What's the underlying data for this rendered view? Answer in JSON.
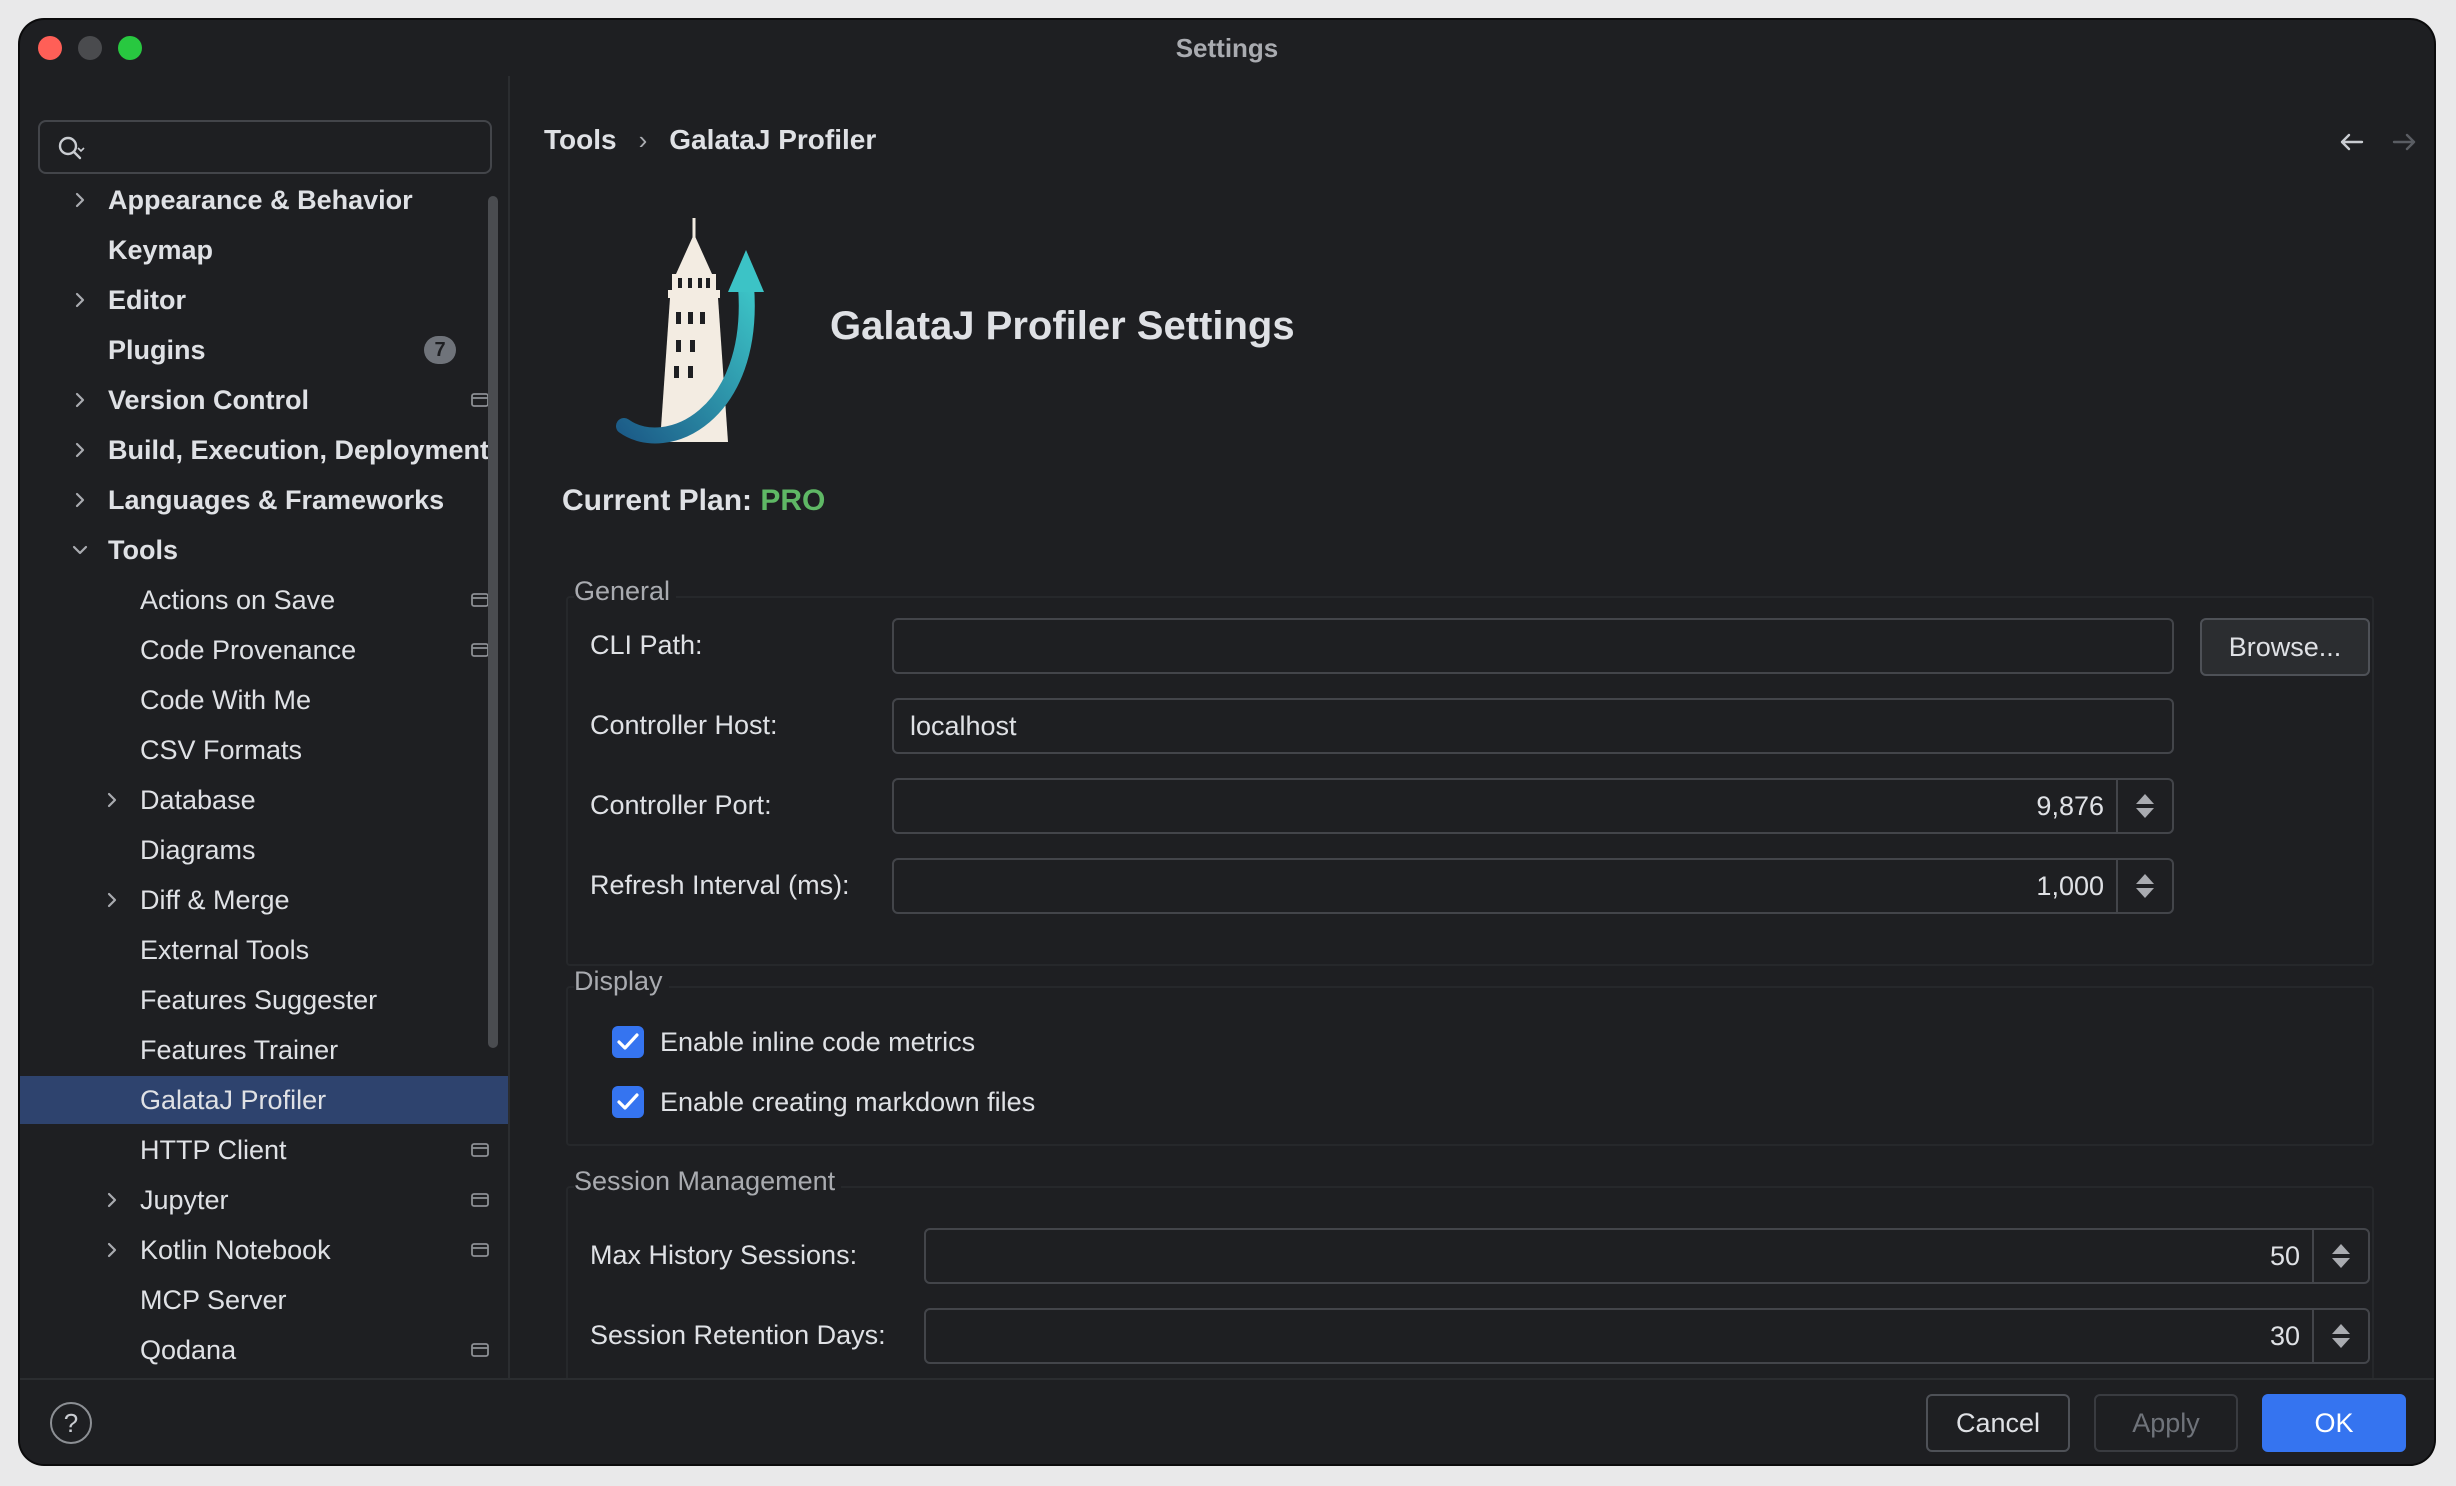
{
  "window": {
    "title": "Settings"
  },
  "search": {
    "placeholder": ""
  },
  "sidebar": {
    "items": [
      {
        "label": "Appearance & Behavior",
        "bold": true,
        "expandable": true,
        "expanded": false,
        "indent": 0
      },
      {
        "label": "Keymap",
        "bold": true,
        "expandable": false,
        "indent": 0
      },
      {
        "label": "Editor",
        "bold": true,
        "expandable": true,
        "expanded": false,
        "indent": 0
      },
      {
        "label": "Plugins",
        "bold": true,
        "expandable": false,
        "indent": 0,
        "badge": "7"
      },
      {
        "label": "Version Control",
        "bold": true,
        "expandable": true,
        "expanded": false,
        "indent": 0,
        "project_icon": true
      },
      {
        "label": "Build, Execution, Deployment",
        "bold": true,
        "expandable": true,
        "expanded": false,
        "indent": 0
      },
      {
        "label": "Languages & Frameworks",
        "bold": true,
        "expandable": true,
        "expanded": false,
        "indent": 0
      },
      {
        "label": "Tools",
        "bold": true,
        "expandable": true,
        "expanded": true,
        "indent": 0
      },
      {
        "label": "Actions on Save",
        "indent": 1,
        "project_icon": true
      },
      {
        "label": "Code Provenance",
        "indent": 1,
        "project_icon": true
      },
      {
        "label": "Code With Me",
        "indent": 1
      },
      {
        "label": "CSV Formats",
        "indent": 1
      },
      {
        "label": "Database",
        "indent": 1,
        "expandable": true,
        "expanded": false
      },
      {
        "label": "Diagrams",
        "indent": 1
      },
      {
        "label": "Diff & Merge",
        "indent": 1,
        "expandable": true,
        "expanded": false
      },
      {
        "label": "External Tools",
        "indent": 1
      },
      {
        "label": "Features Suggester",
        "indent": 1
      },
      {
        "label": "Features Trainer",
        "indent": 1
      },
      {
        "label": "GalataJ Profiler",
        "indent": 1,
        "selected": true
      },
      {
        "label": "HTTP Client",
        "indent": 1,
        "project_icon": true
      },
      {
        "label": "Jupyter",
        "indent": 1,
        "expandable": true,
        "expanded": false,
        "project_icon": true
      },
      {
        "label": "Kotlin Notebook",
        "indent": 1,
        "expandable": true,
        "expanded": false,
        "project_icon": true
      },
      {
        "label": "MCP Server",
        "indent": 1
      },
      {
        "label": "Qodana",
        "indent": 1,
        "project_icon": true
      }
    ]
  },
  "breadcrumb": {
    "parent": "Tools",
    "separator": "›",
    "current": "GalataJ Profiler"
  },
  "plugin": {
    "title": "GalataJ Profiler Settings",
    "plan_label": "Current Plan:",
    "plan_value": "PRO"
  },
  "general": {
    "title": "General",
    "cli_path_label": "CLI Path:",
    "cli_path_value": "",
    "browse_label": "Browse...",
    "host_label": "Controller Host:",
    "host_value": "localhost",
    "port_label": "Controller Port:",
    "port_value": "9,876",
    "refresh_label": "Refresh Interval (ms):",
    "refresh_value": "1,000"
  },
  "display": {
    "title": "Display",
    "inline_metrics_label": "Enable inline code metrics",
    "inline_metrics_checked": true,
    "markdown_label": "Enable creating markdown files",
    "markdown_checked": true
  },
  "session": {
    "title": "Session Management",
    "max_history_label": "Max History Sessions:",
    "max_history_value": "50",
    "retention_label": "Session Retention Days:",
    "retention_value": "30"
  },
  "footer": {
    "help_label": "?",
    "cancel_label": "Cancel",
    "apply_label": "Apply",
    "ok_label": "OK"
  },
  "colors": {
    "accent": "#3574f0",
    "selection": "#2e436e",
    "plan_pro": "#5fb865",
    "background": "#1e1f22"
  }
}
